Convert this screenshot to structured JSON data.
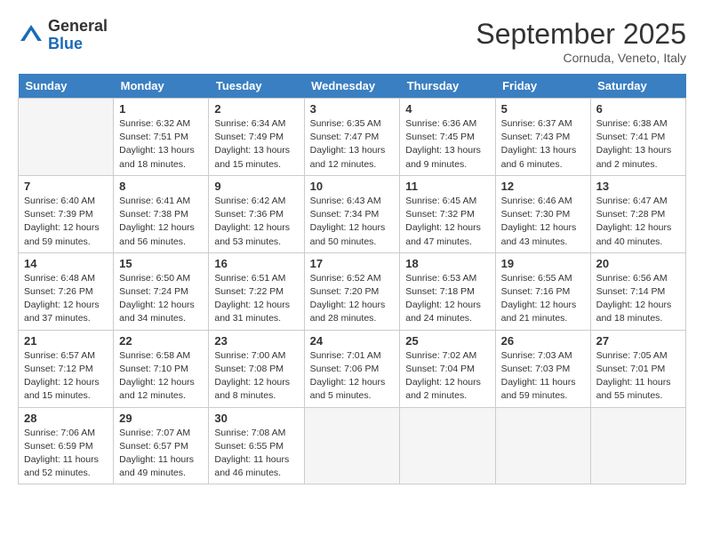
{
  "header": {
    "logo_general": "General",
    "logo_blue": "Blue",
    "month_title": "September 2025",
    "location": "Cornuda, Veneto, Italy"
  },
  "days_of_week": [
    "Sunday",
    "Monday",
    "Tuesday",
    "Wednesday",
    "Thursday",
    "Friday",
    "Saturday"
  ],
  "weeks": [
    [
      {
        "day": "",
        "info": ""
      },
      {
        "day": "1",
        "info": "Sunrise: 6:32 AM\nSunset: 7:51 PM\nDaylight: 13 hours\nand 18 minutes."
      },
      {
        "day": "2",
        "info": "Sunrise: 6:34 AM\nSunset: 7:49 PM\nDaylight: 13 hours\nand 15 minutes."
      },
      {
        "day": "3",
        "info": "Sunrise: 6:35 AM\nSunset: 7:47 PM\nDaylight: 13 hours\nand 12 minutes."
      },
      {
        "day": "4",
        "info": "Sunrise: 6:36 AM\nSunset: 7:45 PM\nDaylight: 13 hours\nand 9 minutes."
      },
      {
        "day": "5",
        "info": "Sunrise: 6:37 AM\nSunset: 7:43 PM\nDaylight: 13 hours\nand 6 minutes."
      },
      {
        "day": "6",
        "info": "Sunrise: 6:38 AM\nSunset: 7:41 PM\nDaylight: 13 hours\nand 2 minutes."
      }
    ],
    [
      {
        "day": "7",
        "info": "Sunrise: 6:40 AM\nSunset: 7:39 PM\nDaylight: 12 hours\nand 59 minutes."
      },
      {
        "day": "8",
        "info": "Sunrise: 6:41 AM\nSunset: 7:38 PM\nDaylight: 12 hours\nand 56 minutes."
      },
      {
        "day": "9",
        "info": "Sunrise: 6:42 AM\nSunset: 7:36 PM\nDaylight: 12 hours\nand 53 minutes."
      },
      {
        "day": "10",
        "info": "Sunrise: 6:43 AM\nSunset: 7:34 PM\nDaylight: 12 hours\nand 50 minutes."
      },
      {
        "day": "11",
        "info": "Sunrise: 6:45 AM\nSunset: 7:32 PM\nDaylight: 12 hours\nand 47 minutes."
      },
      {
        "day": "12",
        "info": "Sunrise: 6:46 AM\nSunset: 7:30 PM\nDaylight: 12 hours\nand 43 minutes."
      },
      {
        "day": "13",
        "info": "Sunrise: 6:47 AM\nSunset: 7:28 PM\nDaylight: 12 hours\nand 40 minutes."
      }
    ],
    [
      {
        "day": "14",
        "info": "Sunrise: 6:48 AM\nSunset: 7:26 PM\nDaylight: 12 hours\nand 37 minutes."
      },
      {
        "day": "15",
        "info": "Sunrise: 6:50 AM\nSunset: 7:24 PM\nDaylight: 12 hours\nand 34 minutes."
      },
      {
        "day": "16",
        "info": "Sunrise: 6:51 AM\nSunset: 7:22 PM\nDaylight: 12 hours\nand 31 minutes."
      },
      {
        "day": "17",
        "info": "Sunrise: 6:52 AM\nSunset: 7:20 PM\nDaylight: 12 hours\nand 28 minutes."
      },
      {
        "day": "18",
        "info": "Sunrise: 6:53 AM\nSunset: 7:18 PM\nDaylight: 12 hours\nand 24 minutes."
      },
      {
        "day": "19",
        "info": "Sunrise: 6:55 AM\nSunset: 7:16 PM\nDaylight: 12 hours\nand 21 minutes."
      },
      {
        "day": "20",
        "info": "Sunrise: 6:56 AM\nSunset: 7:14 PM\nDaylight: 12 hours\nand 18 minutes."
      }
    ],
    [
      {
        "day": "21",
        "info": "Sunrise: 6:57 AM\nSunset: 7:12 PM\nDaylight: 12 hours\nand 15 minutes."
      },
      {
        "day": "22",
        "info": "Sunrise: 6:58 AM\nSunset: 7:10 PM\nDaylight: 12 hours\nand 12 minutes."
      },
      {
        "day": "23",
        "info": "Sunrise: 7:00 AM\nSunset: 7:08 PM\nDaylight: 12 hours\nand 8 minutes."
      },
      {
        "day": "24",
        "info": "Sunrise: 7:01 AM\nSunset: 7:06 PM\nDaylight: 12 hours\nand 5 minutes."
      },
      {
        "day": "25",
        "info": "Sunrise: 7:02 AM\nSunset: 7:04 PM\nDaylight: 12 hours\nand 2 minutes."
      },
      {
        "day": "26",
        "info": "Sunrise: 7:03 AM\nSunset: 7:03 PM\nDaylight: 11 hours\nand 59 minutes."
      },
      {
        "day": "27",
        "info": "Sunrise: 7:05 AM\nSunset: 7:01 PM\nDaylight: 11 hours\nand 55 minutes."
      }
    ],
    [
      {
        "day": "28",
        "info": "Sunrise: 7:06 AM\nSunset: 6:59 PM\nDaylight: 11 hours\nand 52 minutes."
      },
      {
        "day": "29",
        "info": "Sunrise: 7:07 AM\nSunset: 6:57 PM\nDaylight: 11 hours\nand 49 minutes."
      },
      {
        "day": "30",
        "info": "Sunrise: 7:08 AM\nSunset: 6:55 PM\nDaylight: 11 hours\nand 46 minutes."
      },
      {
        "day": "",
        "info": ""
      },
      {
        "day": "",
        "info": ""
      },
      {
        "day": "",
        "info": ""
      },
      {
        "day": "",
        "info": ""
      }
    ]
  ]
}
